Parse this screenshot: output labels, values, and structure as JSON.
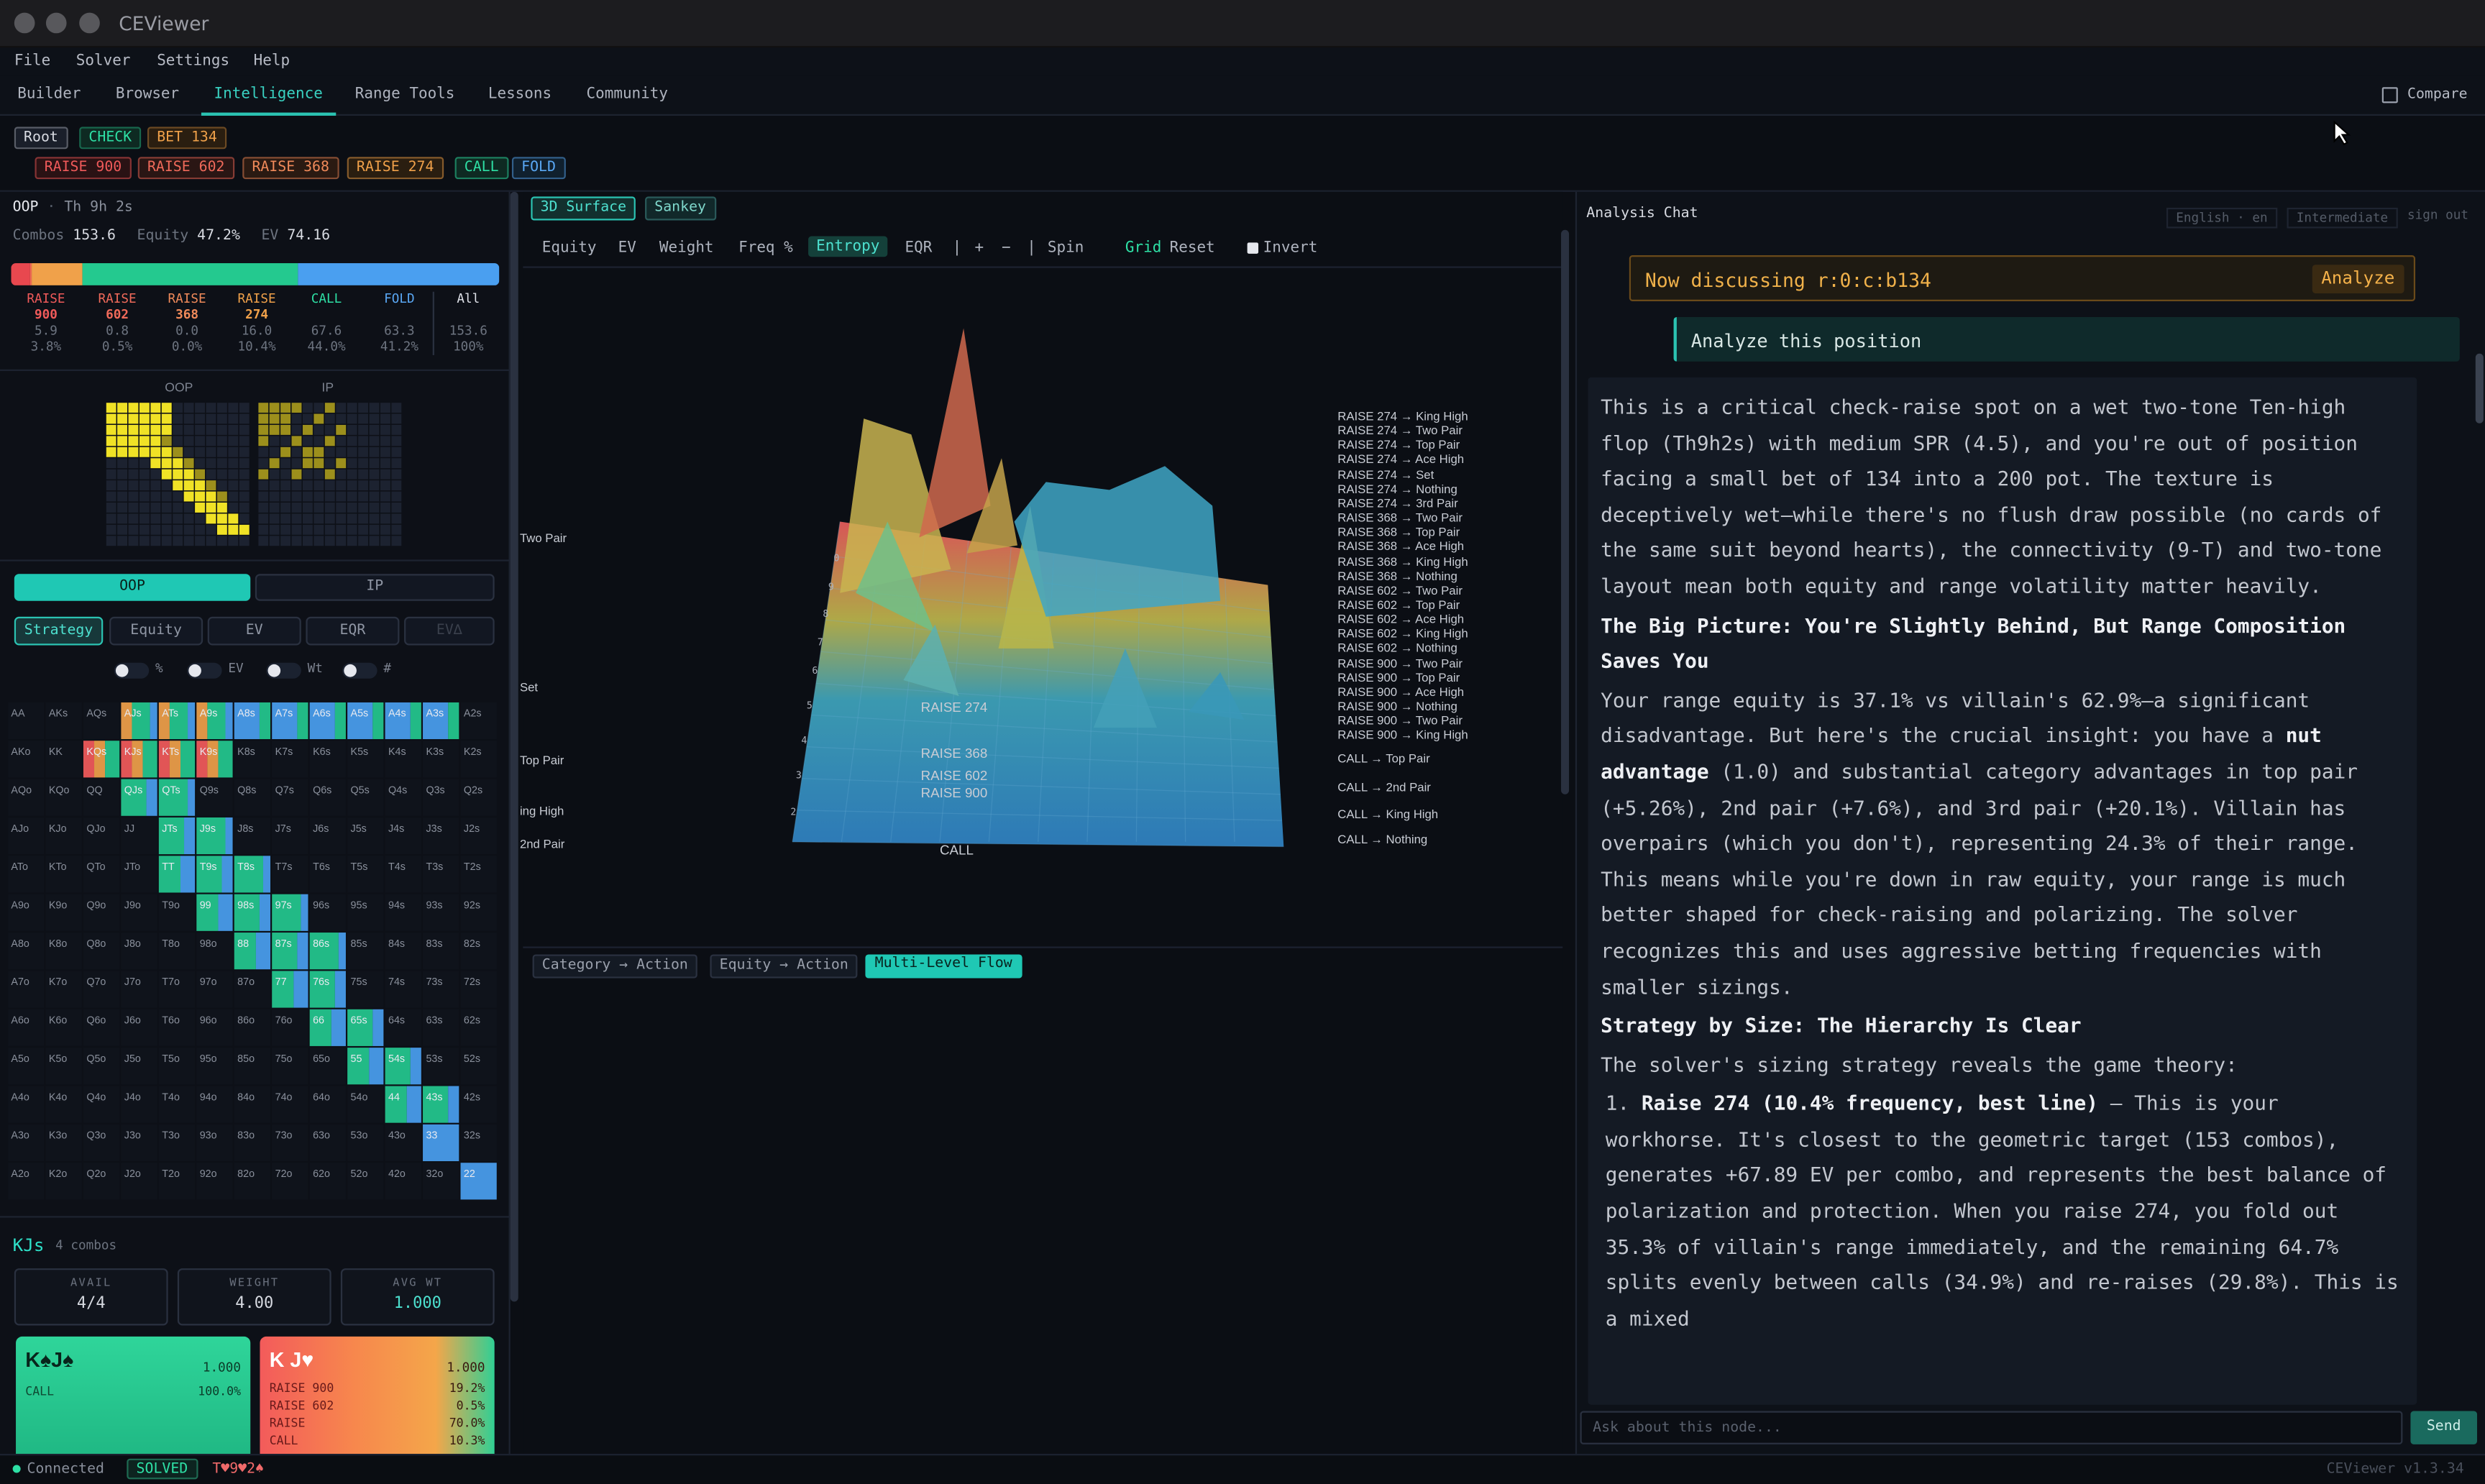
{
  "app_title": "CEViewer",
  "menu": [
    "File",
    "Solver",
    "Settings",
    "Help"
  ],
  "tabs": [
    "Builder",
    "Browser",
    "Intelligence",
    "Range Tools",
    "Lessons",
    "Community"
  ],
  "compare_label": "Compare",
  "crumbs_row1": [
    {
      "label": "Root",
      "color": "#d8dbe2",
      "bg": "#1a1f2a"
    },
    {
      "label": "CHECK",
      "color": "#2ee0a5",
      "bg": "#0e2a22"
    },
    {
      "label": "BET 134",
      "color": "#f0a14a",
      "bg": "#2a1e10"
    }
  ],
  "crumbs_row2": [
    {
      "label": "RAISE 900",
      "color": "#f05a5a",
      "bg": "#2a1214"
    },
    {
      "label": "RAISE 602",
      "color": "#f06a5a",
      "bg": "#2a1614"
    },
    {
      "label": "RAISE 368",
      "color": "#f08a5a",
      "bg": "#2a1a12"
    },
    {
      "label": "RAISE 274",
      "color": "#f0a14a",
      "bg": "#2a1e10"
    },
    {
      "label": "CALL",
      "color": "#2ee0a5",
      "bg": "#0e2a22"
    },
    {
      "label": "FOLD",
      "color": "#5aa8f5",
      "bg": "#10202e"
    }
  ],
  "left": {
    "player": "OOP",
    "sep": "·",
    "timer": "Th 9h 2s",
    "combos_label": "Combos",
    "combos": "153.6",
    "equity_label": "Equity",
    "equity": "47.2%",
    "ev_label": "EV",
    "ev": "74.16",
    "actions": [
      {
        "name": "RAISE",
        "size": "900",
        "a": "5.9",
        "b": "3.8%",
        "color": "#f05a5a"
      },
      {
        "name": "RAISE",
        "size": "602",
        "a": "0.8",
        "b": "0.5%",
        "color": "#f06a5a"
      },
      {
        "name": "RAISE",
        "size": "368",
        "a": "0.0",
        "b": "0.0%",
        "color": "#f08a5a"
      },
      {
        "name": "RAISE",
        "size": "274",
        "a": "16.0",
        "b": "10.4%",
        "color": "#f0a14a"
      },
      {
        "name": "CALL",
        "size": "",
        "a": "67.6",
        "b": "44.0%",
        "color": "#2ee0a5"
      },
      {
        "name": "FOLD",
        "size": "",
        "a": "63.3",
        "b": "41.2%",
        "color": "#5aa8f5"
      },
      {
        "name": "All",
        "size": "",
        "a": "153.6",
        "b": "100%",
        "color": "#e0e3ea"
      }
    ],
    "mini_oop": "OOP",
    "mini_ip": "IP",
    "toggle_oop": "OOP",
    "toggle_ip": "IP",
    "modes": [
      "Strategy",
      "Equity",
      "EV",
      "EQR",
      "EV∆"
    ],
    "switches": [
      "%",
      "EV",
      "Wt",
      "#"
    ],
    "selected_hand": "KJs",
    "selected_combos": "4 combos",
    "stats": [
      {
        "k": "AVAIL",
        "v": "4/4"
      },
      {
        "k": "WEIGHT",
        "v": "4.00"
      },
      {
        "k": "AVG WT",
        "v": "1.000"
      }
    ],
    "card1": {
      "hand": "K♠J♠",
      "weight": "1.000",
      "act": "CALL",
      "pct": "100.0%"
    },
    "card2": {
      "hand": "K J♥",
      "weight": "1.000",
      "rows": [
        [
          "RAISE 900",
          "19.2%"
        ],
        [
          "RAISE 602",
          "0.5%"
        ],
        [
          "RAISE",
          "70.0%"
        ],
        [
          "CALL",
          "10.3%"
        ]
      ]
    }
  },
  "center": {
    "view_tabs": [
      "3D Surface",
      "Sankey"
    ],
    "toolbar": [
      "Equity",
      "EV",
      "Weight",
      "Freq %",
      "Entropy",
      "EQR",
      "|",
      "+",
      "−",
      "|",
      "Spin",
      "Grid",
      "Reset"
    ],
    "invert": "Invert",
    "z_ticks": [
      "0",
      "9",
      "8",
      "7",
      "6",
      "5",
      "4",
      "3",
      "2"
    ],
    "flow_tabs": [
      "Category → Action",
      "Equity → Action",
      "Multi-Level Flow"
    ],
    "sankey_left": [
      "Two Pair",
      "Set",
      "Top Pair",
      "ing High",
      "2nd Pair"
    ],
    "sankey_mid": [
      "RAISE 274",
      "RAISE 368",
      "RAISE 602",
      "RAISE 900",
      "CALL"
    ],
    "sankey_right": [
      "RAISE 274 → King High",
      "RAISE 274 → Two Pair",
      "RAISE 274 → Top Pair",
      "RAISE 274 → Ace High",
      "RAISE 274 → Set",
      "RAISE 274 → Nothing",
      "RAISE 274 → 3rd Pair",
      "RAISE 368 → Two Pair",
      "RAISE 368 → Top Pair",
      "RAISE 368 → Ace High",
      "RAISE 368 → King High",
      "RAISE 368 → Nothing",
      "RAISE 602 → Two Pair",
      "RAISE 602 → Top Pair",
      "RAISE 602 → Ace High",
      "RAISE 602 → King High",
      "RAISE 602 → Nothing",
      "RAISE 900 → Two Pair",
      "RAISE 900 → Top Pair",
      "RAISE 900 → Ace High",
      "RAISE 900 → Nothing",
      "RAISE 900 → Two Pair",
      "RAISE 900 → King High"
    ],
    "sankey_right_call": [
      "CALL → Top Pair",
      "CALL → 2nd Pair",
      "CALL → King High",
      "CALL → Nothing"
    ]
  },
  "chat": {
    "title": "Analysis Chat",
    "lang": "English · en",
    "level": "Intermediate",
    "signout": "sign out",
    "discussing": "Now discussing r:0:c:b134",
    "analyze_btn": "Analyze",
    "user_msg": "Analyze this position",
    "p1": "This is a critical check-raise spot on a wet two-tone Ten-high flop (Th9h2s) with medium SPR (4.5), and you're out of position facing a small bet of 134 into a 200 pot. The texture is deceptively wet—while there's no flush draw possible (no cards of the same suit beyond hearts), the connectivity (9-T) and two-tone layout mean both equity and range volatility matter heavily.",
    "h1": "The Big Picture: You're Slightly Behind, But Range Composition Saves You",
    "p2a": "Your range equity is 37.1% vs villain's 62.9%—a significant disadvantage. But here's the crucial insight: you have a ",
    "p2b": "nut advantage",
    "p2c": " (1.0) and substantial category advantages in top pair (+5.26%), 2nd pair (+7.6%), and 3rd pair (+20.1%). Villain has overpairs (which you don't), representing 24.3% of their range. This means while you're down in raw equity, your range is much better shaped for check-raising and polarizing. The solver recognizes this and uses aggressive betting frequencies with smaller sizings.",
    "h2": "Strategy by Size: The Hierarchy Is Clear",
    "p3": "The solver's sizing strategy reveals the game theory:",
    "li_num": "1.",
    "li_b": "Raise 274 (10.4% frequency, best line)",
    "li_t": " — This is your workhorse. It's closest to the geometric target (153 combos), generates +67.89 EV per combo, and represents the best balance of polarization and protection. When you raise 274, you fold out 35.3% of villain's range immediately, and the remaining 64.7% splits evenly between calls (34.9%) and re-raises (29.8%). This is a mixed",
    "input_placeholder": "Ask about this node...",
    "send": "Send"
  },
  "status": {
    "connected": "Connected",
    "solved": "SOLVED",
    "board": "T♥9♥2♠",
    "version": "CEViewer v1.3.34"
  }
}
